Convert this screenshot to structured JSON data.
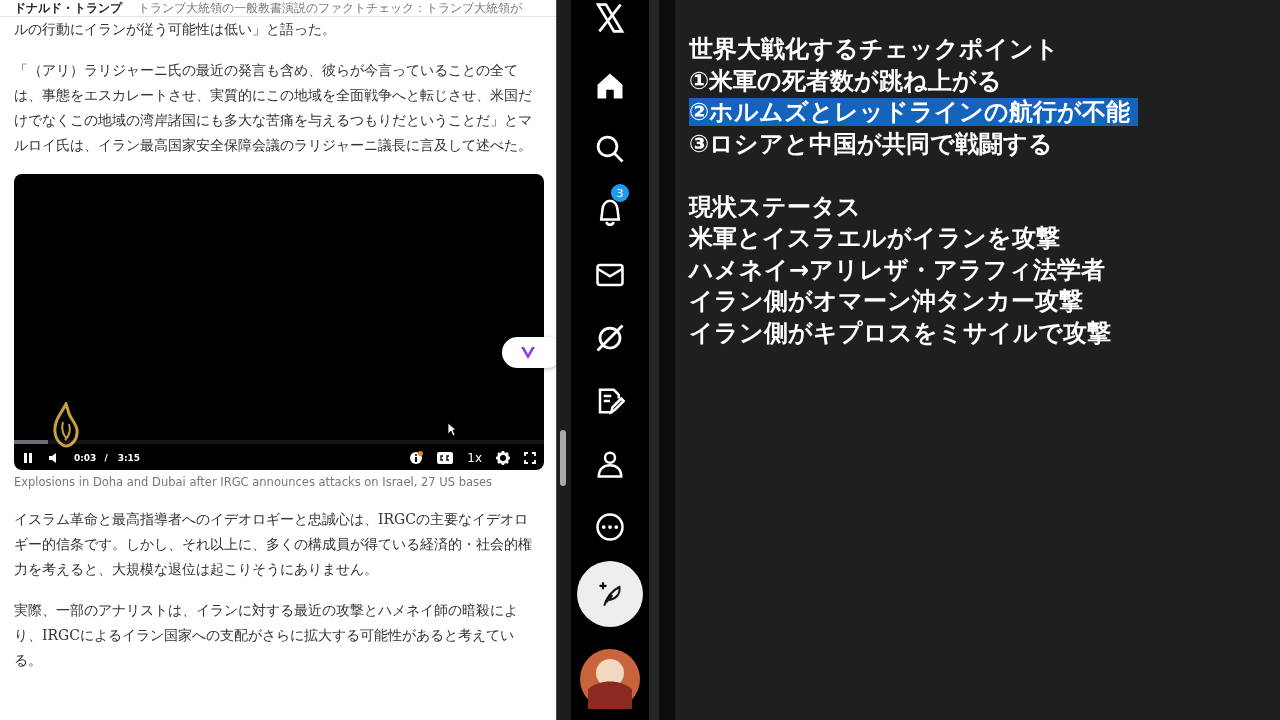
{
  "article": {
    "header": {
      "author": "ドナルド・トランプ",
      "related": "トランプ大統領の一般教書演説のファクトチェック：トランプ大統領が"
    },
    "paragraphs_top": [
      "ルの行動にイランが従う可能性は低い」と語った。",
      "「（アリ）ラリジャーニ氏の最近の発言も含め、彼らが今言っていることの全ては、事態をエスカレートさせ、実質的にこの地域を全面戦争へと転じさせ、米国だけでなくこの地域の湾岸諸国にも多大な苦痛を与えるつもりだということだ」とマルロイ氏は、イラン最高国家安全保障会議のラリジャーニ議長に言及して述べた。"
    ],
    "video": {
      "playing": true,
      "level": 0.065,
      "current_time": "0:03",
      "separator": "/",
      "duration": "3:15",
      "speed": "1x",
      "info_alert": true,
      "caption": "Explosions in Doha and Dubai after IRGC announces attacks on Israel, 27 US bases"
    },
    "paragraphs_bottom": [
      "イスラム革命と最高指導者へのイデオロギーと忠誠心は、IRGCの主要なイデオロギー的信条です。しかし、それ以上に、多くの構成員が得ている経済的・社会的権力を考えると、大規模な退位は起こりそうにありません。",
      "実際、一部のアナリストは、イランに対する最近の攻撃とハメネイ師の暗殺により、IRGCによるイラン国家への支配がさらに拡大する可能性があると考えている。"
    ]
  },
  "sidebar": {
    "items": [
      {
        "kind": "logo"
      },
      {
        "kind": "home"
      },
      {
        "kind": "search"
      },
      {
        "kind": "notifications",
        "badge": "3"
      },
      {
        "kind": "messages"
      },
      {
        "kind": "grok"
      },
      {
        "kind": "drafts"
      },
      {
        "kind": "profile"
      },
      {
        "kind": "more"
      },
      {
        "kind": "compose"
      },
      {
        "kind": "avatar"
      }
    ]
  },
  "overlay": {
    "sections": [
      {
        "lines": [
          {
            "text": "世界大戦化するチェックポイント",
            "highlighted": false
          },
          {
            "text": "①米軍の死者数が跳ね上がる",
            "highlighted": false
          },
          {
            "text": "②ホルムズとレッドラインの航行が不能",
            "highlighted": true
          },
          {
            "text": "③ロシアと中国が共同で戦闘する",
            "highlighted": false
          }
        ]
      },
      {
        "lines": [
          {
            "text": "現状ステータス",
            "highlighted": false
          },
          {
            "text": "米軍とイスラエルがイランを攻撃",
            "highlighted": false
          },
          {
            "text": "ハメネイ→アリレザ・アラフィ法学者",
            "highlighted": false
          },
          {
            "text": "イラン側がオマーン沖タンカー攻撃",
            "highlighted": false
          },
          {
            "text": "イラン側がキプロスをミサイルで攻撃",
            "highlighted": false
          }
        ]
      }
    ]
  }
}
